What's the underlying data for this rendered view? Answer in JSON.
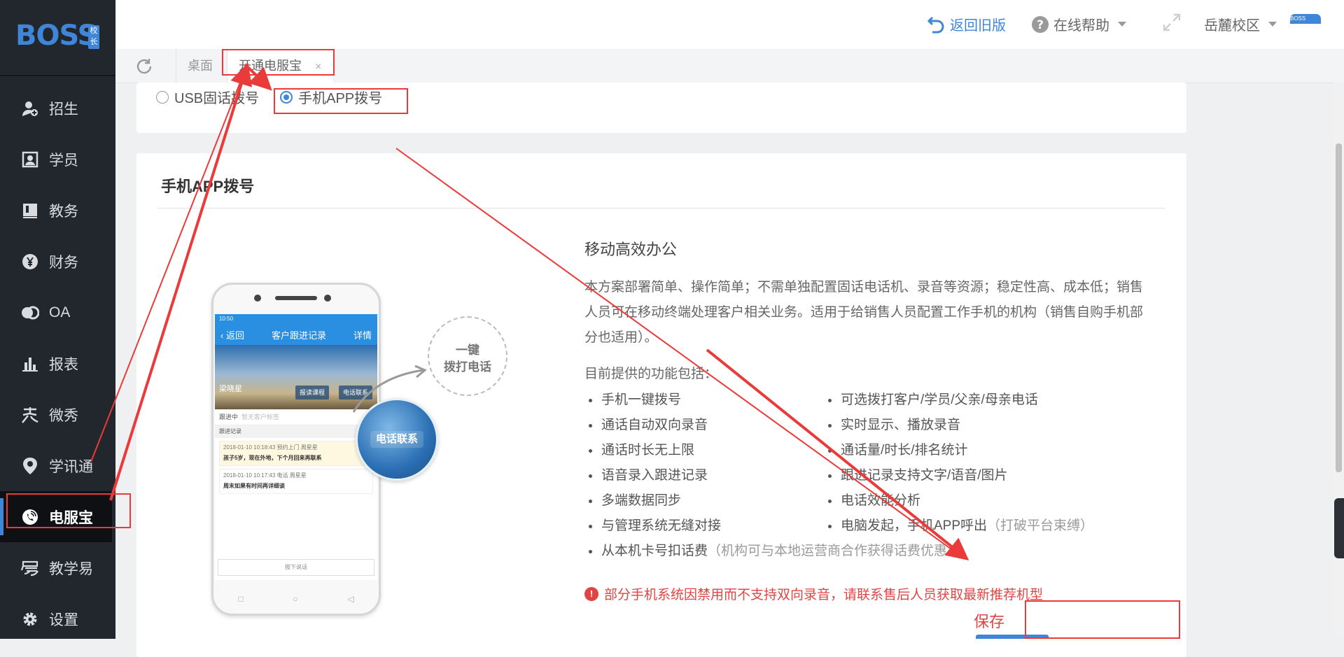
{
  "brand": {
    "logo_text": "BOSS",
    "logo_tag": "校长",
    "badge": "BOSS"
  },
  "sidebar": {
    "items": [
      {
        "label": "招生",
        "icon": "user-plus-icon"
      },
      {
        "label": "学员",
        "icon": "id-card-icon"
      },
      {
        "label": "教务",
        "icon": "book-icon"
      },
      {
        "label": "财务",
        "icon": "yen-coin-icon"
      },
      {
        "label": "OA",
        "icon": "chat-bubbles-icon"
      },
      {
        "label": "报表",
        "icon": "bar-chart-icon"
      },
      {
        "label": "微秀",
        "icon": "show-icon"
      },
      {
        "label": "学讯通",
        "icon": "location-pin-icon"
      },
      {
        "label": "电服宝",
        "icon": "phone-service-icon",
        "active": true
      },
      {
        "label": "教学易",
        "icon": "teach-icon"
      },
      {
        "label": "设置",
        "icon": "gear-icon"
      }
    ]
  },
  "topbar": {
    "back_label": "返回旧版",
    "help_label": "在线帮助",
    "campus_label": "岳麓校区"
  },
  "tabs": {
    "desktop": "桌面",
    "active": "开通电服宝",
    "close": "×"
  },
  "dial_mode": {
    "options": [
      "USB固话拨号",
      "手机APP拨号"
    ],
    "selected": "手机APP拨号"
  },
  "panel": {
    "title": "手机APP拨号",
    "heading": "移动高效办公",
    "description": "本方案部署简单、操作简单；不需单独配置固话电话机、录音等资源；稳定性高、成本低；销售人员可在移动终端处理客户相关业务。适用于给销售人员配置工作手机的机构（销售自购手机部分也适用）。",
    "features_intro": "目前提供的功能包括：",
    "features_left": [
      "手机一键拨号",
      "通话自动双向录音",
      "通话时长无上限",
      "语音录入跟进记录",
      "多端数据同步",
      "与管理系统无缝对接",
      "从本机卡号扣话费"
    ],
    "features_left_note": "（机构可与本地运营商合作获得话费优惠）",
    "features_right": [
      "可选拨打客户/学员/父亲/母亲电话",
      "实时显示、播放录音",
      "通话量/时长/排名统计",
      "跟进记录支持文字/语音/图片",
      "电话效能分析",
      "电脑发起，手机APP呼出"
    ],
    "features_right_note": "（打破平台束缚）",
    "warning": "部分手机系统因禁用而不支持双向录音，请联系售后人员获取最新推荐机型",
    "save_label": "保存"
  },
  "illustration": {
    "status_time": "10:50",
    "back": "返回",
    "screen_title": "客户跟进记录",
    "detail": "详情",
    "customer_name": "梁晓星",
    "btn_course": "报读课程",
    "btn_call": "电话联系",
    "following": "跟进中",
    "no_schedule": "暂无客户标签",
    "record_header": "跟进记录",
    "rec1_meta": "2018-01-10 10:18:43   预约上门   周星星",
    "rec1_text": "孩子5岁，现在外地，下个月回来再联系",
    "rec2_meta": "2018-01-10 10:17:43   电话   周星星",
    "rec2_text": "周末如果有时间再详细谈",
    "input_hint": "按下说话",
    "call_label": "电话联系",
    "bubble_line1": "一键",
    "bubble_line2": "拨打电话"
  },
  "colors": {
    "accent": "#3f86d8",
    "annotation": "#ea3a3a",
    "sidebar_bg": "#22262d"
  }
}
